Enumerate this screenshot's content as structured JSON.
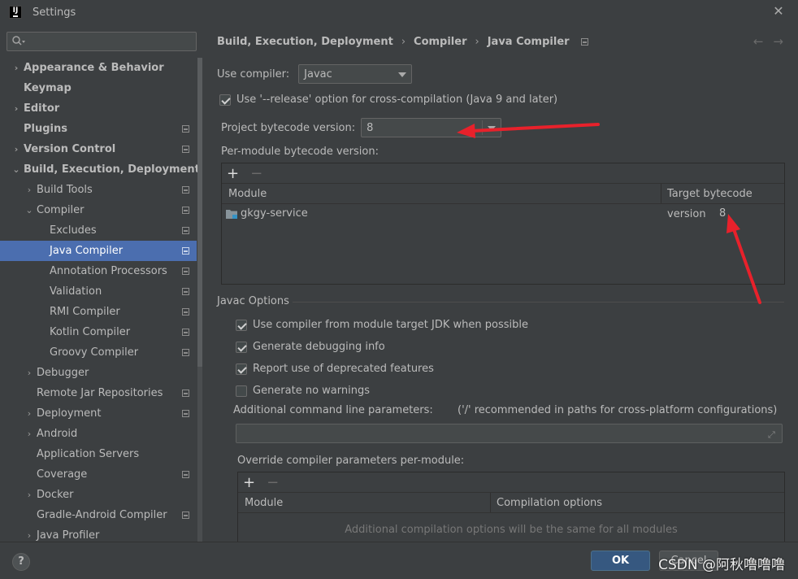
{
  "window": {
    "title": "Settings",
    "app_icon_text": "IJ"
  },
  "sidebar": {
    "search": {
      "value": "",
      "placeholder": ""
    },
    "items": [
      {
        "label": "Appearance & Behavior",
        "level": 0,
        "arrow": "›",
        "bold": true,
        "project": false,
        "selected": false
      },
      {
        "label": "Keymap",
        "level": 0,
        "arrow": "",
        "bold": true,
        "project": false,
        "selected": false
      },
      {
        "label": "Editor",
        "level": 0,
        "arrow": "›",
        "bold": true,
        "project": false,
        "selected": false
      },
      {
        "label": "Plugins",
        "level": 0,
        "arrow": "",
        "bold": true,
        "project": true,
        "selected": false
      },
      {
        "label": "Version Control",
        "level": 0,
        "arrow": "›",
        "bold": true,
        "project": true,
        "selected": false
      },
      {
        "label": "Build, Execution, Deployment",
        "level": 0,
        "arrow": "⌄",
        "bold": true,
        "project": false,
        "selected": false
      },
      {
        "label": "Build Tools",
        "level": 1,
        "arrow": "›",
        "bold": false,
        "project": true,
        "selected": false
      },
      {
        "label": "Compiler",
        "level": 1,
        "arrow": "⌄",
        "bold": false,
        "project": true,
        "selected": false
      },
      {
        "label": "Excludes",
        "level": 2,
        "arrow": "",
        "bold": false,
        "project": true,
        "selected": false
      },
      {
        "label": "Java Compiler",
        "level": 2,
        "arrow": "",
        "bold": false,
        "project": true,
        "selected": true
      },
      {
        "label": "Annotation Processors",
        "level": 2,
        "arrow": "",
        "bold": false,
        "project": true,
        "selected": false
      },
      {
        "label": "Validation",
        "level": 2,
        "arrow": "",
        "bold": false,
        "project": true,
        "selected": false
      },
      {
        "label": "RMI Compiler",
        "level": 2,
        "arrow": "",
        "bold": false,
        "project": true,
        "selected": false
      },
      {
        "label": "Kotlin Compiler",
        "level": 2,
        "arrow": "",
        "bold": false,
        "project": true,
        "selected": false
      },
      {
        "label": "Groovy Compiler",
        "level": 2,
        "arrow": "",
        "bold": false,
        "project": true,
        "selected": false
      },
      {
        "label": "Debugger",
        "level": 1,
        "arrow": "›",
        "bold": false,
        "project": false,
        "selected": false
      },
      {
        "label": "Remote Jar Repositories",
        "level": 1,
        "arrow": "",
        "bold": false,
        "project": true,
        "selected": false
      },
      {
        "label": "Deployment",
        "level": 1,
        "arrow": "›",
        "bold": false,
        "project": true,
        "selected": false
      },
      {
        "label": "Android",
        "level": 1,
        "arrow": "›",
        "bold": false,
        "project": false,
        "selected": false
      },
      {
        "label": "Application Servers",
        "level": 1,
        "arrow": "",
        "bold": false,
        "project": false,
        "selected": false
      },
      {
        "label": "Coverage",
        "level": 1,
        "arrow": "",
        "bold": false,
        "project": true,
        "selected": false
      },
      {
        "label": "Docker",
        "level": 1,
        "arrow": "›",
        "bold": false,
        "project": false,
        "selected": false
      },
      {
        "label": "Gradle-Android Compiler",
        "level": 1,
        "arrow": "",
        "bold": false,
        "project": true,
        "selected": false
      },
      {
        "label": "Java Profiler",
        "level": 1,
        "arrow": "›",
        "bold": false,
        "project": false,
        "selected": false
      }
    ]
  },
  "breadcrumb": {
    "parts": [
      "Build, Execution, Deployment",
      "Compiler",
      "Java Compiler"
    ],
    "sep": "›"
  },
  "nav": {
    "back": "←",
    "forward": "→"
  },
  "compiler": {
    "use_compiler_label": "Use compiler:",
    "use_compiler_value": "Javac",
    "release_option_label": "Use '--release' option for cross-compilation (Java 9 and later)",
    "release_option_checked": true,
    "bytecode_label": "Project bytecode version:",
    "bytecode_value": "8",
    "per_module_label": "Per-module bytecode version:",
    "module_table": {
      "add": "+",
      "remove": "−",
      "headers": [
        "Module",
        "Target bytecode version"
      ],
      "rows": [
        {
          "module": "gkgy-service",
          "target": "8"
        }
      ]
    }
  },
  "javac_options": {
    "title": "Javac Options",
    "checkboxes": [
      {
        "label": "Use compiler from module target JDK when possible",
        "checked": true
      },
      {
        "label": "Generate debugging info",
        "checked": true
      },
      {
        "label": "Report use of deprecated features",
        "checked": true
      },
      {
        "label": "Generate no warnings",
        "checked": false
      }
    ],
    "additional_label": "Additional command line parameters:",
    "additional_hint": "('/' recommended in paths for cross-platform configurations)",
    "additional_value": "",
    "expand_icon": "⤢",
    "override_label": "Override compiler parameters per-module:",
    "override_table": {
      "add": "+",
      "remove": "−",
      "headers": [
        "Module",
        "Compilation options"
      ],
      "empty_text": "Additional compilation options will be the same for all modules"
    }
  },
  "footer": {
    "help": "?",
    "ok": "OK",
    "cancel": "Cancel",
    "watermark": "CSDN @阿秋噜噜噜"
  },
  "colors": {
    "selection": "#4b6eaf",
    "annotation_arrow": "#e8212b",
    "ok_button": "#365880"
  }
}
